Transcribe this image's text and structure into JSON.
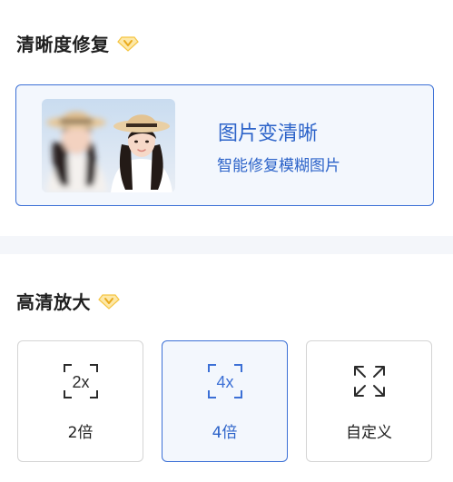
{
  "clarity": {
    "title": "清晰度修复",
    "card": {
      "title": "图片变清晰",
      "subtitle": "智能修复模糊图片"
    }
  },
  "upscale": {
    "title": "高清放大",
    "options": [
      {
        "label": "2倍",
        "icon_text": "2x",
        "selected": false
      },
      {
        "label": "4倍",
        "icon_text": "4x",
        "selected": true
      },
      {
        "label": "自定义",
        "icon": "expand-arrows-icon",
        "selected": false
      }
    ]
  },
  "colors": {
    "accent": "#2c63c9",
    "vip_gold": "#f5c542",
    "selected_bg": "#f3f7fd",
    "divider": "#f4f6fa"
  }
}
